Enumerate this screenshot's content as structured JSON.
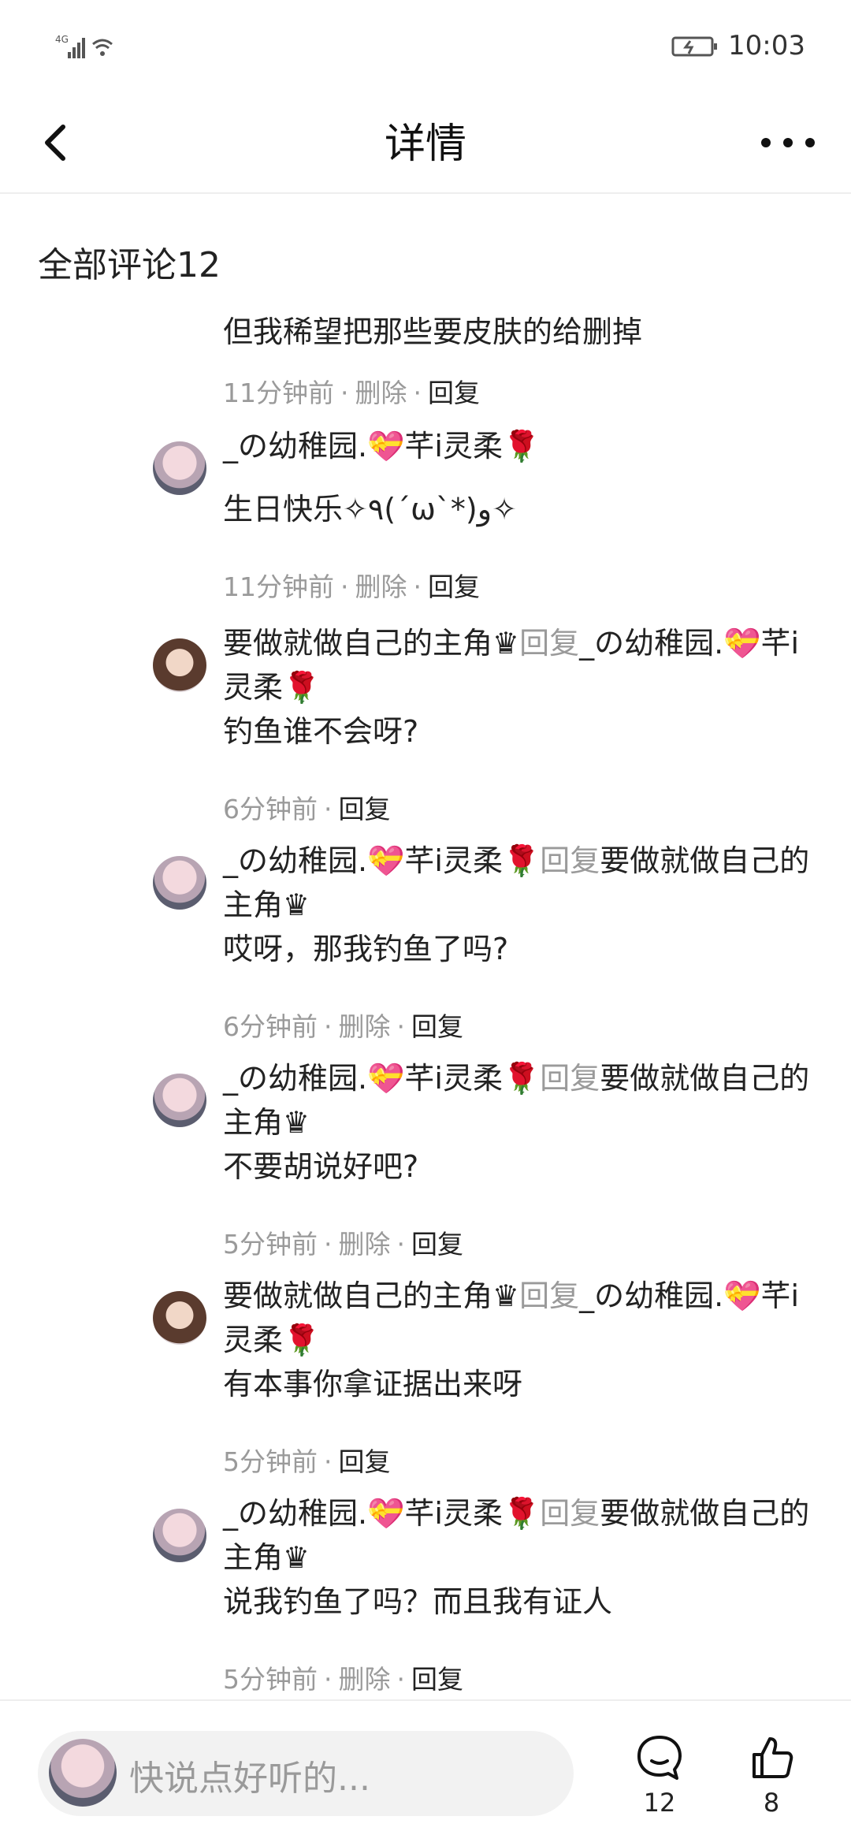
{
  "status_bar": {
    "network": "4G",
    "time": "10:03"
  },
  "header": {
    "title": "详情"
  },
  "comments_title": "全部评论12",
  "partial_comment": {
    "text": "但我稀望把那些要皮肤的给删掉",
    "time": "11分钟前",
    "delete": "删除",
    "reply": "回复"
  },
  "comments": [
    {
      "name": "_の幼稚园.💝芊i灵柔🌹",
      "reply_word": "",
      "reply_to": "",
      "text": "生日快乐✧٩(ˊωˋ*)و✧",
      "time": "11分钟前",
      "delete": "删除",
      "reply": "回复"
    },
    {
      "name": "要做就做自己的主角♛",
      "reply_word": "回复",
      "reply_to": "_の幼稚园.💝芊i灵柔🌹",
      "text": "钓鱼谁不会呀?",
      "time": "6分钟前",
      "delete": "",
      "reply": "回复"
    },
    {
      "name": "_の幼稚园.💝芊i灵柔🌹",
      "reply_word": "回复",
      "reply_to": "要做就做自己的主角♛",
      "text": "哎呀，那我钓鱼了吗?",
      "time": "6分钟前",
      "delete": "删除",
      "reply": "回复"
    },
    {
      "name": "_の幼稚园.💝芊i灵柔🌹",
      "reply_word": "回复",
      "reply_to": "要做就做自己的主角♛",
      "text": "不要胡说好吧?",
      "time": "5分钟前",
      "delete": "删除",
      "reply": "回复"
    },
    {
      "name": "要做就做自己的主角♛",
      "reply_word": "回复",
      "reply_to": "_の幼稚园.💝芊i灵柔🌹",
      "text": "有本事你拿证据出来呀",
      "time": "5分钟前",
      "delete": "",
      "reply": "回复"
    },
    {
      "name": "_の幼稚园.💝芊i灵柔🌹",
      "reply_word": "回复",
      "reply_to": "要做就做自己的主角♛",
      "text": "说我钓鱼了吗？而且我有证人",
      "time": "5分钟前",
      "delete": "删除",
      "reply": "回复"
    }
  ],
  "bottom_bar": {
    "placeholder": "快说点好听的...",
    "comment_count": "12",
    "like_count": "8"
  },
  "colors": {
    "accent_gray": "#9a9a9a",
    "text": "#222222"
  }
}
